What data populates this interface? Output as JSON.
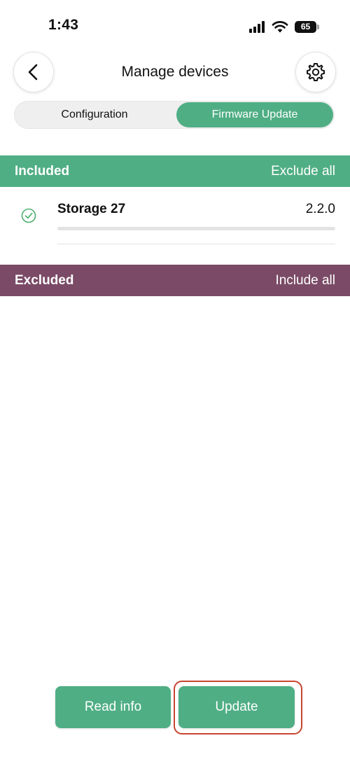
{
  "status_bar": {
    "time": "1:43",
    "battery_level": "65"
  },
  "header": {
    "title": "Manage devices",
    "back_icon": "chevron-left-icon",
    "settings_icon": "gear-icon"
  },
  "tabs": {
    "configuration": "Configuration",
    "firmware_update": "Firmware Update",
    "selected": "Firmware Update"
  },
  "included": {
    "title": "Included",
    "action": "Exclude all",
    "color": "#4fae84",
    "devices": [
      {
        "name": "Storage 27",
        "version": "2.2.0",
        "status_icon": "check-circle-icon",
        "progress": 0
      }
    ]
  },
  "excluded": {
    "title": "Excluded",
    "action": "Include all",
    "color": "#7a4a66"
  },
  "actions": {
    "read_info": "Read info",
    "update": "Update"
  },
  "colors": {
    "accent": "#4fae84",
    "excluded": "#7a4a66",
    "highlight": "#c8452f"
  }
}
